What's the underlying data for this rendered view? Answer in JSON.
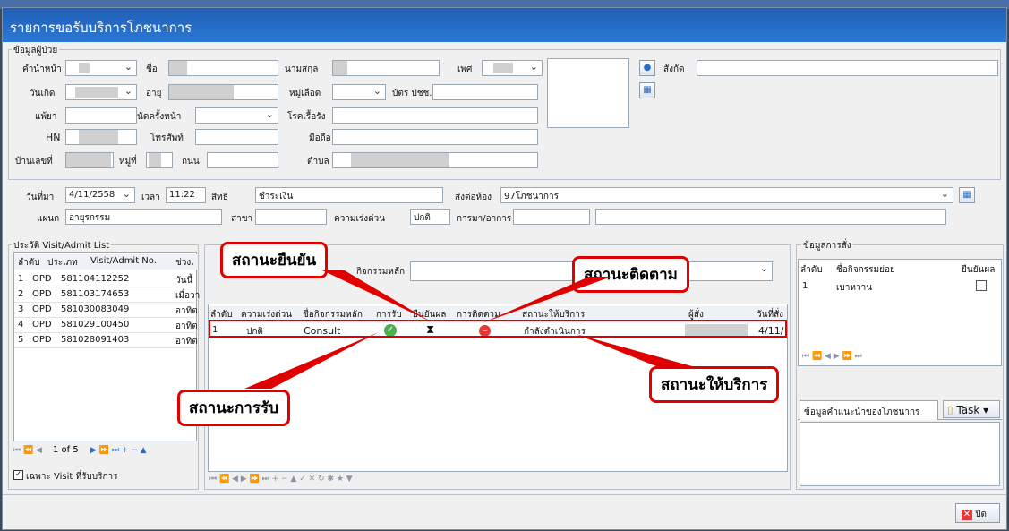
{
  "title": "รายการขอรับบริการโภชนาการ",
  "patient": {
    "section": "ข้อมูลผู้ป่วย",
    "prefix_label": "คำนำหน้า",
    "name_label": "ชื่อ",
    "surname_label": "นามสกุล",
    "sex_label": "เพศ",
    "dept_label": "สังกัด",
    "dob_label": "วันเกิด",
    "age_label": "อายุ",
    "blood_label": "หมู่เลือด",
    "id_label": "บัตร ปชช.",
    "allergy_label": "แพ้ยา",
    "card_label": "นัดครั้งหน้า",
    "chronic_label": "โรคเรื้อรัง",
    "hn_label": "HN",
    "phone_label": "โทรศัพท์",
    "mobile_label": "มือถือ",
    "addr_label": "บ้านเลขที่",
    "moo_label": "หมู่ที่",
    "road_label": "ถนน",
    "tambon_label": "ตำบล"
  },
  "visit": {
    "date_label": "วันที่มา",
    "date_value": "4/11/2558",
    "time_label": "เวลา",
    "time_value": "11:22",
    "right_label": "สิทธิ",
    "right_value": "ชำระเงิน",
    "send_label": "ส่งต่อห้อง",
    "send_value": "97โภชนาการ",
    "dept_label": "แผนก",
    "dept_value": "อายุรกรรม",
    "branch_label": "สาขา",
    "urgency_label": "ความเร่งด่วน",
    "urgency_value": "ปกติ",
    "symptom_label": "การมา/อาการ"
  },
  "history": {
    "title": "ประวัติ Visit/Admit List",
    "headers": [
      "ลำดับ",
      "ประเภท",
      "Visit/Admit No.",
      "ช่วงเ"
    ],
    "rows": [
      {
        "no": "1",
        "type": "OPD",
        "vn": "581104112252",
        "extra": "วันนี้"
      },
      {
        "no": "2",
        "type": "OPD",
        "vn": "581103174653",
        "extra": "เมื่อวา"
      },
      {
        "no": "3",
        "type": "OPD",
        "vn": "581030083049",
        "extra": "อาทิต"
      },
      {
        "no": "4",
        "type": "OPD",
        "vn": "581029100450",
        "extra": "อาทิต"
      },
      {
        "no": "5",
        "type": "OPD",
        "vn": "581028091403",
        "extra": "อาทิต"
      }
    ],
    "pager": "1 of 5",
    "only_label": "เฉพาะ Visit ที่รับบริการ"
  },
  "service": {
    "main_activity_label": "กิจกรรมหลัก",
    "headers": [
      "ลำดับ",
      "ความเร่งด่วน",
      "ชื่อกิจกรรมหลัก",
      "การรับ",
      "ยืนยันผล",
      "การติดตาม",
      "สถานะให้บริการ",
      "ผู้สั่ง",
      "วันที่สั่ง"
    ],
    "row": {
      "no": "1",
      "urgency": "ปกติ",
      "activity": "Consult",
      "status": "กำลังดำเนินการ",
      "date": "4/11/"
    }
  },
  "order": {
    "title": "ข้อมูลการสั่ง",
    "headers": [
      "ลำดับ",
      "ชื่อกิจกรรมย่อย",
      "ยืนยันผล"
    ],
    "row": {
      "no": "1",
      "name": "เบาหวาน"
    }
  },
  "advice": {
    "tab": "ข้อมูลคำแนะนำของโภชนากร",
    "task": "Task"
  },
  "close_label": "ปิด",
  "callouts": {
    "confirm": "สถานะยืนยัน",
    "follow": "สถานะติดตาม",
    "receive": "สถานะการรับ",
    "service": "สถานะให้บริการ"
  },
  "colors": {
    "accent": "#2b78d6",
    "highlight": "#e00000"
  }
}
